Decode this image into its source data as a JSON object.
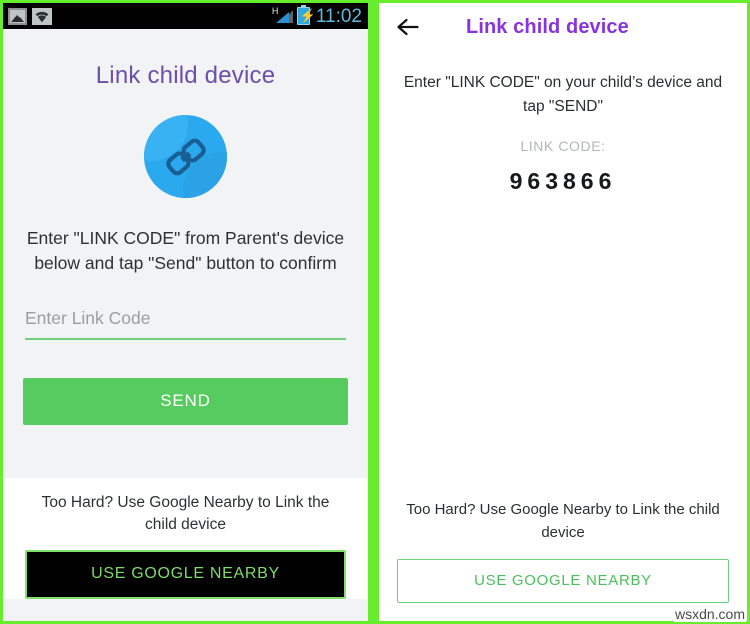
{
  "left_phone": {
    "statusbar": {
      "icons": [
        "photo-icon",
        "wifi-icon",
        "signal-icon",
        "battery-charging-icon"
      ],
      "network_type": "H",
      "clock": "11:02"
    },
    "title": "Link child device",
    "hero_icon": "chain-link-icon",
    "description": "Enter \"LINK CODE\" from Parent's device below and tap \"Send\" button to confirm",
    "link_code_input": {
      "placeholder": "Enter Link Code",
      "value": ""
    },
    "send_button": "SEND",
    "nearby_note": "Too Hard? Use Google Nearby to Link the child device",
    "nearby_button": "USE GOOGLE NEARBY"
  },
  "right_phone": {
    "back_icon": "arrow-left-icon",
    "title": "Link child device",
    "description": "Enter \"LINK CODE\" on your child’s device and tap \"SEND\"",
    "link_code_label": "LINK CODE:",
    "link_code_value": "963866",
    "nearby_note": "Too Hard? Use Google Nearby to Link the child device",
    "nearby_button": "USE GOOGLE NEARBY"
  },
  "watermark": "wsxdn.com",
  "colors": {
    "frame_green": "#66ee2e",
    "send_green": "#56cc5e",
    "outline_green": "#6fcf7b",
    "left_title_purple": "#6b4fa8",
    "right_title_purple": "#8833dd",
    "link_circle_blue": "#2aa9ef",
    "left_bg": "#f1f3f5",
    "statusbar_bg": "#000000",
    "clock_blue": "#5fb9da"
  }
}
